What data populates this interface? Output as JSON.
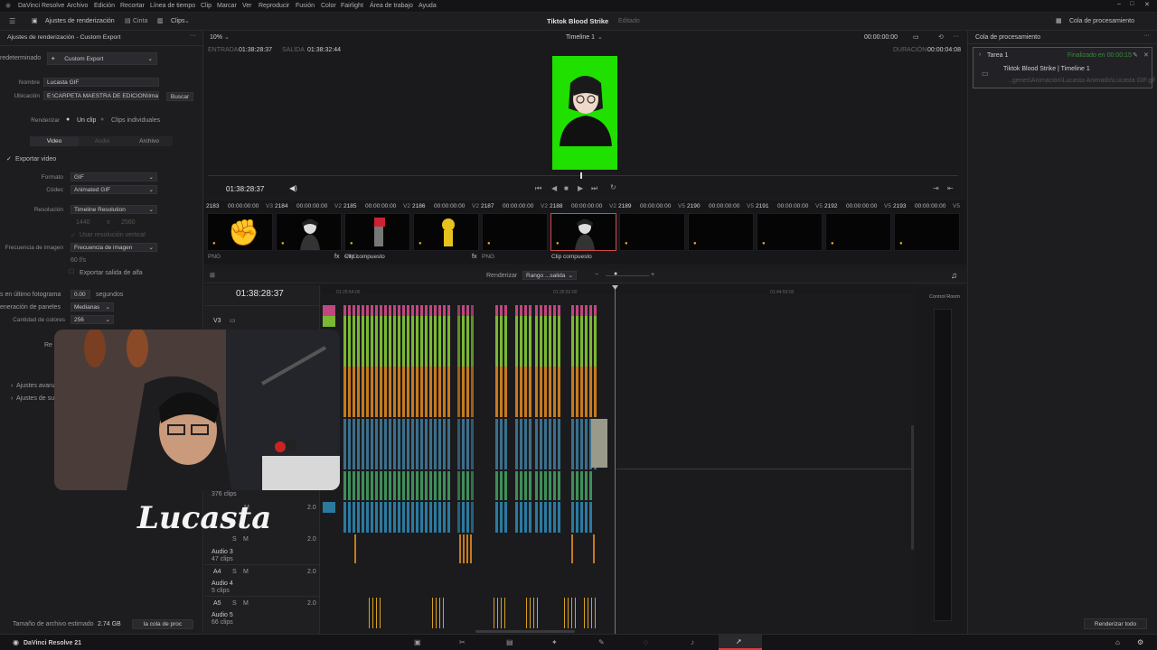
{
  "menu": {
    "app": "DaVinci Resolve",
    "items": [
      "Archivo",
      "Edición",
      "Recortar",
      "Línea de tiempo",
      "Clip",
      "Marcar",
      "Ver",
      "Reproducir",
      "Fusión",
      "Color",
      "Fairlight",
      "Área de trabajo",
      "Ayuda"
    ]
  },
  "toolbar": {
    "render_settings": "Ajustes de renderización",
    "tape": "Cinta",
    "clips": "Clips",
    "project_title": "Tiktok Blood Strike",
    "edited": "Editado",
    "render_queue_btn": "Cola de procesamiento"
  },
  "left": {
    "header": "Ajustes de renderización - Custom Export",
    "preset_label": "redeterminado",
    "preset_value": "Custom Export",
    "name_label": "Nombre",
    "name_value": "Lucasta GIF",
    "location_label": "Ubicación",
    "location_value": "E:\\CARPETA MAESTRA DE EDICION\\Image",
    "browse": "Buscar",
    "render_label": "Renderizar",
    "one_clip": "Un clip",
    "individual_clips": "Clips individuales",
    "tab_video": "Video",
    "tab_audio": "Audio",
    "tab_file": "Archivo",
    "export_video": "Exportar video",
    "format_label": "Formato",
    "format_value": "GIF",
    "codec_label": "Códec",
    "codec_value": "Animated GIF",
    "resolution_label": "Resolución",
    "resolution_value": "Timeline Resolution",
    "res_w": "1440",
    "res_x": "x",
    "res_h": "2560",
    "vertical_res": "Usar resolución vertical",
    "framerate_label": "Frecuencia de imagen",
    "framerate_value": "Frecuencia de imagen",
    "fps": "60 f/s",
    "alpha_export": "Exportar salida de alfa",
    "last_frame_label": "s en último fotograma",
    "last_frame_value": "0.00",
    "seconds": "segundos",
    "panel_gen_label": "eneración de paneles",
    "panel_gen_value": "Medianas",
    "colors_label": "Cantidad de colores",
    "colors_value": "256",
    "re": "Re",
    "advanced": "Ajustes avanz",
    "sub_settings": "Ajustes de su",
    "file_size_label": "Tamaño de archivo estimado",
    "file_size_value": "2.74 GB",
    "add_queue": "la cola de proc"
  },
  "viewer": {
    "zoom": "10%",
    "timeline_name": "Timeline 1",
    "tc_top": "00:00:00:00",
    "in_label": "ENTRADA",
    "in_tc": "01:38:28:37",
    "out_label": "SALIDA",
    "out_tc": "01:38:32:44",
    "dur_label": "DURACIÓN",
    "dur_tc": "00:00:04:08",
    "playhead_tc": "01:38:28:37"
  },
  "clips": [
    {
      "num": "2183",
      "tc": "00:00:00:00",
      "track": "V3",
      "label": "PNG",
      "fx": ""
    },
    {
      "num": "2184",
      "tc": "00:00:00:00",
      "track": "V2",
      "label": "Clip compuesto",
      "fx": "fx"
    },
    {
      "num": "2185",
      "tc": "00:00:00:00",
      "track": "V2",
      "label": "PNG",
      "fx": ""
    },
    {
      "num": "2186",
      "tc": "00:00:00:00",
      "track": "V2",
      "label": "PNG",
      "fx": "fx"
    },
    {
      "num": "2187",
      "tc": "00:00:00:00",
      "track": "V2",
      "label": "",
      "fx": ""
    },
    {
      "num": "2188",
      "tc": "00:00:00:00",
      "track": "V2",
      "label": "Clip compuesto",
      "fx": ""
    },
    {
      "num": "2189",
      "tc": "00:00:00:00",
      "track": "V5",
      "label": "",
      "fx": ""
    },
    {
      "num": "2190",
      "tc": "00:00:00:00",
      "track": "V5",
      "label": "",
      "fx": ""
    },
    {
      "num": "2191",
      "tc": "00:00:00:00",
      "track": "V5",
      "label": "",
      "fx": ""
    },
    {
      "num": "2192",
      "tc": "00:00:00:00",
      "track": "V5",
      "label": "",
      "fx": ""
    },
    {
      "num": "2193",
      "tc": "00:00:00:00",
      "track": "V5",
      "label": "",
      "fx": ""
    }
  ],
  "timeline": {
    "render_label": "Renderizar",
    "range_value": "Rango ...salida",
    "timecode": "01:38:28:37",
    "ruler": [
      "01:26:54:00",
      "01:35:52:00",
      "01:44:50:00"
    ],
    "v3": "V3",
    "clips_count": "376 clips",
    "audio3": "Audio 3",
    "audio3_clips": "47 clips",
    "a4": "A4",
    "audio4": "Audio 4",
    "audio4_clips": "5 clips",
    "a5": "A5",
    "audio5": "Audio 5",
    "audio5_clips": "66 clips",
    "level": "2.0",
    "control_room": "Control Room"
  },
  "queue": {
    "header": "Cola de procesamiento",
    "task": "Tarea 1",
    "task_status": "Finalizado en 00:00:15",
    "job_title": "Tiktok Blood Strike | Timeline 1",
    "job_path": "...genes\\Animación\\Lucasta Animado\\Lucasta GIF.gif",
    "render_all": "Renderizar todo"
  },
  "status": {
    "app_version": "DaVinci Resolve 21"
  },
  "overlay": {
    "signature": "Lucasta"
  },
  "colors": {
    "green_screen": "#20e000",
    "pink": "#c0477f",
    "lime": "#7ab832",
    "orange": "#c77a1e",
    "blue": "#3b6f8c",
    "green": "#3e8f5a",
    "teal": "#2a7aa0",
    "render_accent": "#e03a3a"
  }
}
